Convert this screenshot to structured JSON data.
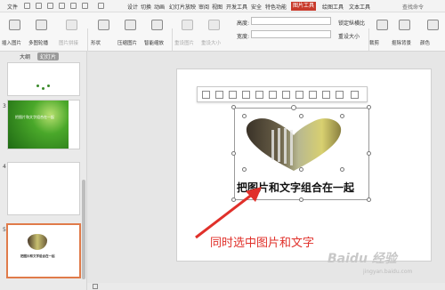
{
  "menubar": {
    "file": "文件",
    "tabs": [
      "设计",
      "切换",
      "动画",
      "幻灯片放映",
      "审阅",
      "视图",
      "开发工具",
      "安全",
      "特色功能",
      "图片工具",
      "绘图工具",
      "文本工具"
    ],
    "active_tab": "图片工具",
    "search": "查找命令"
  },
  "ribbon": {
    "insert_picture": "插入图片",
    "multi_picture": "多图轮播",
    "picture_stitch": "图片拼接",
    "shape": "形状",
    "compress": "压缩图片",
    "smart_zoom": "智能缩放",
    "reset_picture": "重设图片",
    "reset_size": "重设大小",
    "height_label": "高度:",
    "width_label": "宽度:",
    "lock_ratio": "锁定纵横比",
    "reset_size_small": "重设大小",
    "crop": "裁剪",
    "matting": "抠除背景",
    "color": "颜色"
  },
  "left_panel": {
    "tab_outline": "大纲",
    "tab_slides": "幻灯片",
    "slide_numbers": [
      "3",
      "4",
      "5"
    ],
    "slide3_text": "把图片和文字组合在一起",
    "slide5_text": "把图片和文字组合在一起"
  },
  "slide": {
    "caption": "把图片和文字组合在一起"
  },
  "annotation": "同时选中图片和文字",
  "watermark": {
    "logo": "Baidu 经验",
    "url": "jingyan.baidu.com"
  },
  "colors": {
    "accent": "#c83a2b",
    "selected_border": "#e07b4a",
    "annotation": "#e0302a"
  }
}
